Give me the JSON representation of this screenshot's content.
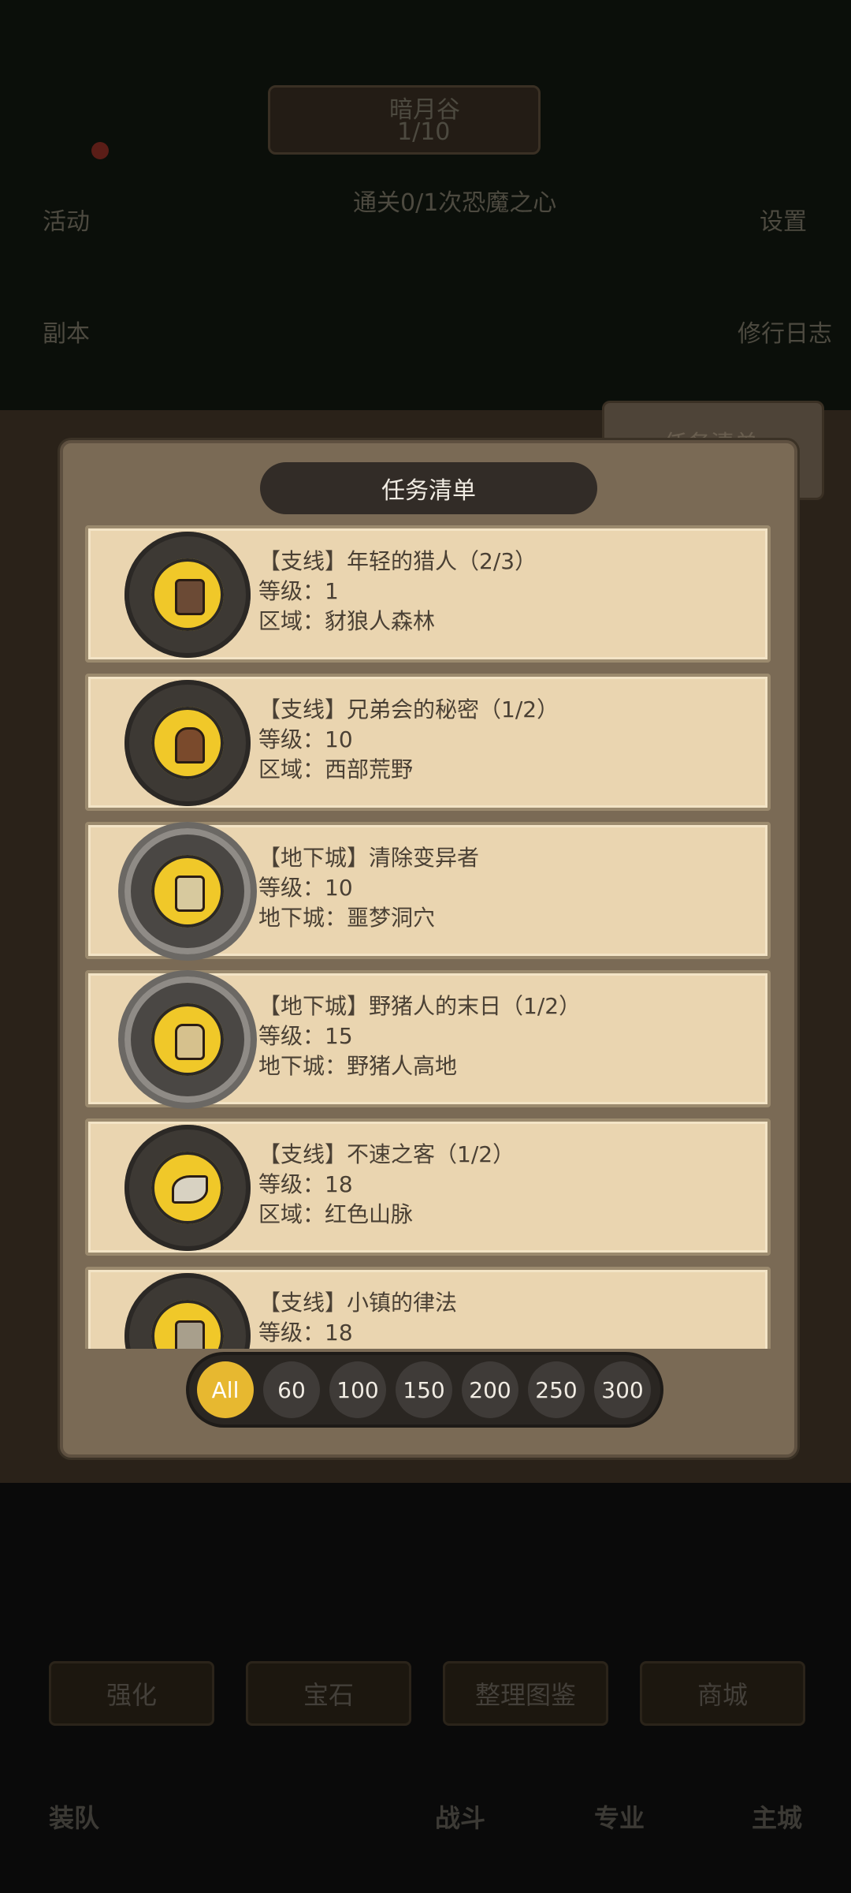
{
  "background": {
    "region_name": "暗月谷",
    "region_progress": "1/10",
    "quest_hint": "通关0/1次恐魔之心",
    "left_button_top": "活动",
    "left_button_mid": "副本",
    "right_button_top": "设置",
    "right_button_mid": "修行日志",
    "task_tab": "任务清单",
    "bottom_buttons": [
      "强化",
      "宝石",
      "整理图鉴",
      "商城"
    ],
    "nav": [
      "装队",
      "战斗",
      "专业",
      "主城"
    ]
  },
  "modal": {
    "title": "任务清单",
    "quests": [
      {
        "title": "【支线】年轻的猎人（2/3）",
        "level": "等级：1",
        "location": "区域：豺狼人森林",
        "icon": "pants-icon",
        "frame": "normal"
      },
      {
        "title": "【支线】兄弟会的秘密（1/2）",
        "level": "等级：10",
        "location": "区域：西部荒野",
        "icon": "helmet-icon",
        "frame": "normal"
      },
      {
        "title": "【地下城】清除变异者",
        "level": "等级：10",
        "location": "地下城：噩梦洞穴",
        "icon": "ore-icon",
        "frame": "dragon"
      },
      {
        "title": "【地下城】野猪人的末日（1/2）",
        "level": "等级：15",
        "location": "地下城：野猪人高地",
        "icon": "sack-icon",
        "frame": "dragon"
      },
      {
        "title": "【支线】不速之客（1/2）",
        "level": "等级：18",
        "location": "区域：红色山脉",
        "icon": "leaf-icon",
        "frame": "normal"
      },
      {
        "title": "【支线】小镇的律法",
        "level": "等级：18",
        "location": "",
        "icon": "cloth-icon",
        "frame": "normal"
      }
    ],
    "filters": [
      "All",
      "60",
      "100",
      "150",
      "200",
      "250",
      "300"
    ],
    "active_filter": "All"
  }
}
